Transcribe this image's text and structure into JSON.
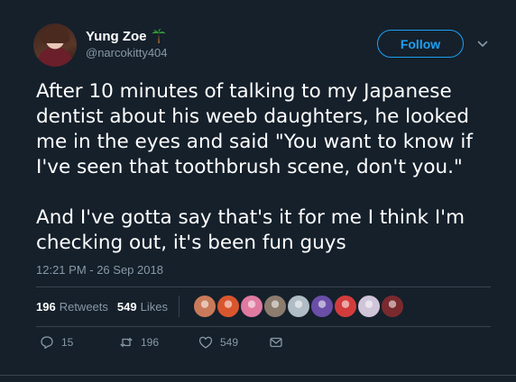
{
  "author": {
    "display_name": "Yung Zoe",
    "emoji_icon": "palm-tree-icon",
    "handle": "@narcokitty404"
  },
  "follow_label": "Follow",
  "tweet": {
    "paragraph_1": "After 10 minutes of talking to my Japanese dentist about his weeb daughters, he looked me in the eyes and said \"You want to know if I've seen that toothbrush scene, don't you.\"",
    "paragraph_2": "And I've gotta say that's it for me I think I'm checking out, it's been fun guys",
    "timestamp": "12:21 PM - 26 Sep 2018"
  },
  "stats": {
    "retweets_count": "196",
    "retweets_label": "Retweets",
    "likes_count": "549",
    "likes_label": "Likes"
  },
  "liker_avatars": [
    {
      "color": "#c97a5a"
    },
    {
      "color": "#d8562e"
    },
    {
      "color": "#e07aa0"
    },
    {
      "color": "#8c7c6e"
    },
    {
      "color": "#b0bcc6"
    },
    {
      "color": "#6a4ea8"
    },
    {
      "color": "#d23c3c"
    },
    {
      "color": "#cfc4d8"
    },
    {
      "color": "#7a2a2e"
    }
  ],
  "actions": {
    "replies": "15",
    "retweets": "196",
    "likes": "549"
  },
  "colors": {
    "background": "#15202b",
    "accent": "#1da1f2",
    "secondary_text": "#8899a6"
  }
}
